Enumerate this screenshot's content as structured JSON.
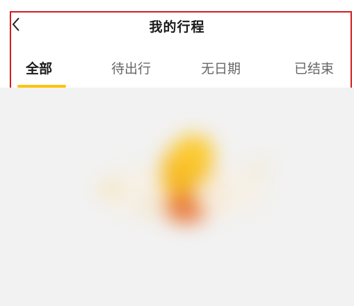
{
  "header": {
    "title": "我的行程",
    "back_icon": "chevron-left-icon"
  },
  "tabs": [
    {
      "label": "全部",
      "active": true
    },
    {
      "label": "待出行",
      "active": false
    },
    {
      "label": "无日期",
      "active": false
    },
    {
      "label": "已结束",
      "active": false
    }
  ],
  "colors": {
    "accent": "#ffc300",
    "highlight_border": "#d11c1c",
    "background": "#f2f2f2"
  },
  "content": {
    "illustration": "empty-state-illustration"
  }
}
